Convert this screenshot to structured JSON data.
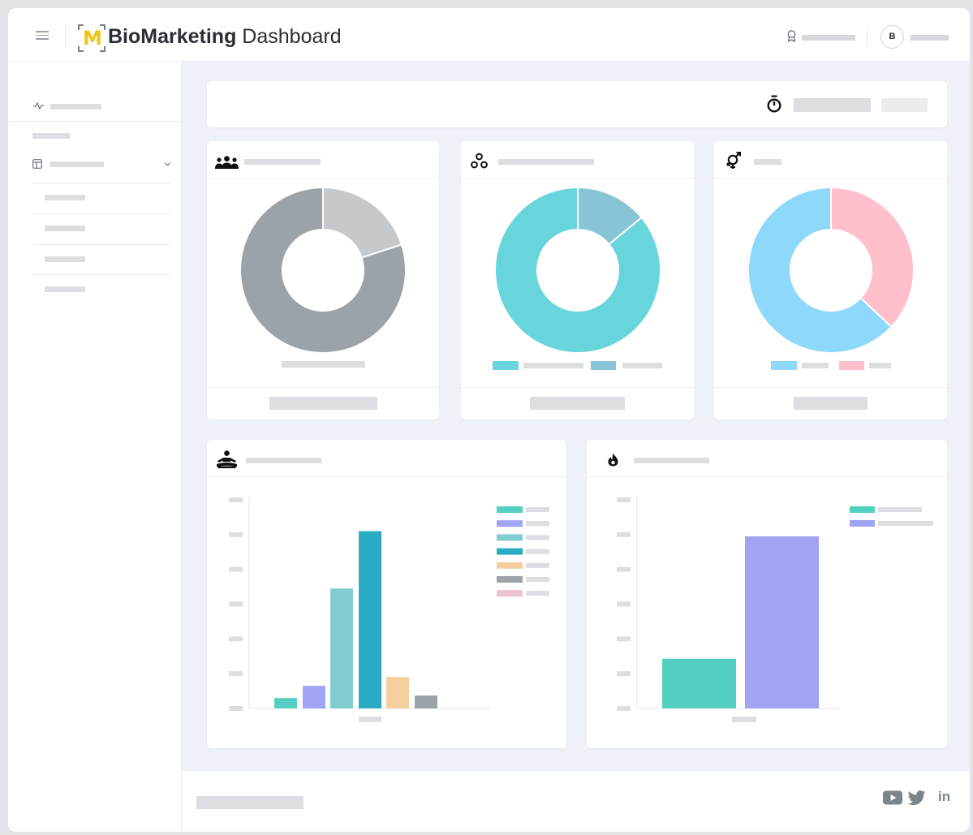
{
  "app": {
    "logo_letter": "M",
    "title_bold": "BioMarketing",
    "title_rest": " Dashboard"
  },
  "user": {
    "avatar_initial": "B"
  },
  "icons": {
    "menu": "hamburger-icon",
    "award": "award-icon",
    "activity": "activity-icon",
    "layout": "layout-icon",
    "chevron": "chevron-down-icon",
    "timer": "stopwatch-icon",
    "users": "users-icon",
    "segments": "circles-icon",
    "gender": "gender-icon",
    "meditation": "meditation-icon",
    "fire": "fire-icon",
    "youtube": "youtube-icon",
    "twitter": "twitter-icon",
    "linkedin": "linkedin-icon"
  },
  "social": {
    "linkedin_text": "in"
  },
  "colors": {
    "gray_light": "#c5c9cc",
    "gray_dark": "#9ca3a8",
    "teal": "#68d4dc",
    "steel": "#88c4d6",
    "sky": "#8ed9fb",
    "pink": "#ffc0cb",
    "mint": "#54d0c2",
    "lavender": "#a1a3f3",
    "aqua": "#7fcdd1",
    "cyan_dark": "#2bacc4",
    "peach": "#f5cf9e",
    "slate": "#9ca3a8",
    "rose": "#e9c3cd"
  },
  "chart_data": [
    {
      "type": "pie",
      "slices": [
        {
          "value": 20,
          "color": "#c5c9cc"
        },
        {
          "value": 80,
          "color": "#9ca3a8"
        }
      ]
    },
    {
      "type": "pie",
      "slices": [
        {
          "value": 14,
          "color": "#88c4d6"
        },
        {
          "value": 86,
          "color": "#68d4dc"
        }
      ]
    },
    {
      "type": "pie",
      "slices": [
        {
          "value": 37,
          "color": "#ffc0cb"
        },
        {
          "value": 63,
          "color": "#8ed9fb"
        }
      ]
    },
    {
      "type": "bar",
      "ylim": [
        0,
        6
      ],
      "values": [
        0.3,
        0.65,
        3.45,
        5.1,
        0.9,
        0.37
      ],
      "colors": [
        "#54d0c2",
        "#a1a3f3",
        "#7fcdd1",
        "#2bacc4",
        "#f5cf9e",
        "#9ca3a8"
      ],
      "legend_colors": [
        "#54d0c2",
        "#a1a3f3",
        "#7fcdd1",
        "#2bacc4",
        "#f5cf9e",
        "#9ca3a8",
        "#e9c3cd"
      ]
    },
    {
      "type": "bar",
      "ylim": [
        0,
        6
      ],
      "values": [
        1.43,
        4.95
      ],
      "colors": [
        "#54d0c2",
        "#a1a3f3"
      ],
      "legend_colors": [
        "#54d0c2",
        "#a1a3f3"
      ]
    }
  ]
}
